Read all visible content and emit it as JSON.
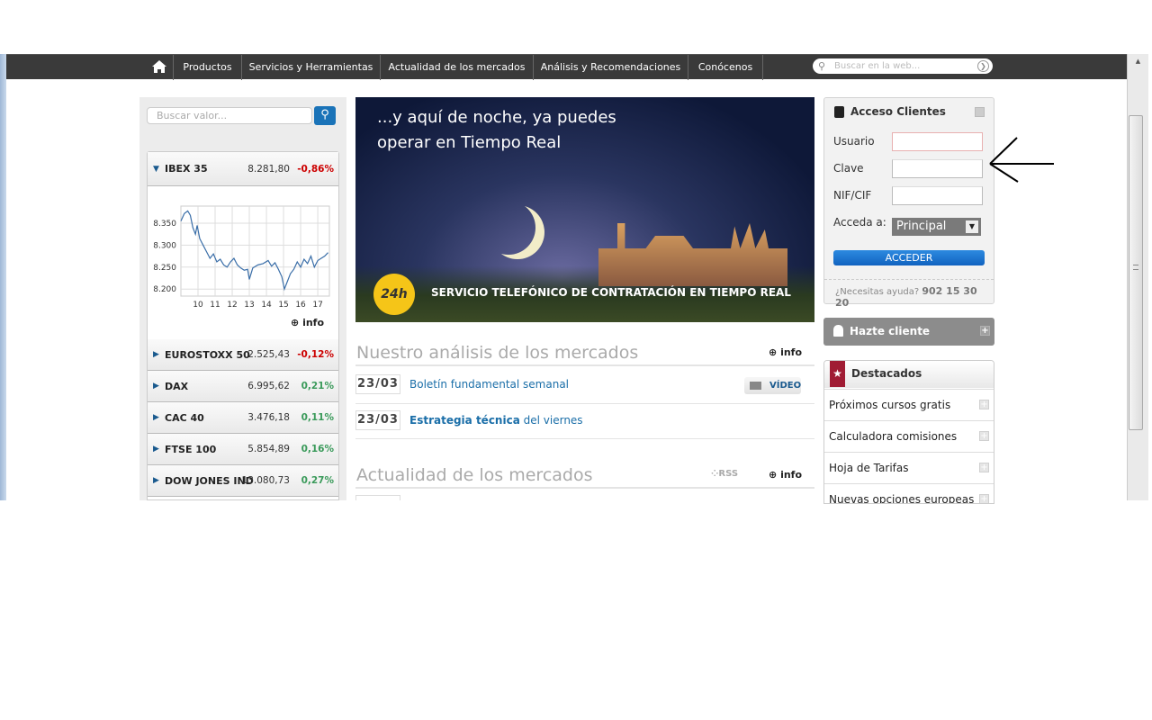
{
  "nav": {
    "items": [
      "Productos",
      "Servicios y Herramientas",
      "Actualidad de los mercados",
      "Análisis y Recomendaciones",
      "Conócenos"
    ],
    "search_placeholder": "Buscar en la web..."
  },
  "left": {
    "search_placeholder": "Buscar valor...",
    "indices": [
      {
        "name": "IBEX 35",
        "value": "8.281,80",
        "change": "-0,86%",
        "dir": "neg"
      },
      {
        "name": "EUROSTOXX 50",
        "value": "2.525,43",
        "change": "-0,12%",
        "dir": "neg"
      },
      {
        "name": "DAX",
        "value": "6.995,62",
        "change": "0,21%",
        "dir": "pos"
      },
      {
        "name": "CAC 40",
        "value": "3.476,18",
        "change": "0,11%",
        "dir": "pos"
      },
      {
        "name": "FTSE 100",
        "value": "5.854,89",
        "change": "0,16%",
        "dir": "pos"
      },
      {
        "name": "DOW JONES IND",
        "value": "13.080,73",
        "change": "0,27%",
        "dir": "pos"
      }
    ],
    "info_label": "info",
    "ibex_chart": {
      "type": "line",
      "y_ticks": [
        "8.350",
        "8.300",
        "8.250",
        "8.200"
      ],
      "y_tick_values": [
        8350,
        8300,
        8250,
        8200
      ],
      "x_ticks": [
        "10",
        "11",
        "12",
        "13",
        "14",
        "15",
        "16",
        "17"
      ],
      "x_tick_values": [
        10,
        11,
        12,
        13,
        14,
        15,
        16,
        17
      ],
      "xlim": [
        9.0,
        17.68
      ],
      "ylim": [
        8184,
        8389
      ],
      "x": [
        9.0,
        9.2,
        9.4,
        9.55,
        9.7,
        9.85,
        9.95,
        10.1,
        10.3,
        10.5,
        10.7,
        10.9,
        11.1,
        11.3,
        11.5,
        11.7,
        11.9,
        12.1,
        12.3,
        12.5,
        12.7,
        12.9,
        13.0,
        13.2,
        13.5,
        13.8,
        14.1,
        14.3,
        14.5,
        14.7,
        14.9,
        15.05,
        15.2,
        15.4,
        15.6,
        15.8,
        16.0,
        16.2,
        16.4,
        16.6,
        16.8,
        17.0,
        17.2,
        17.4,
        17.6
      ],
      "y": [
        8355,
        8372,
        8378,
        8368,
        8340,
        8325,
        8345,
        8315,
        8300,
        8285,
        8270,
        8280,
        8262,
        8268,
        8255,
        8250,
        8262,
        8270,
        8255,
        8248,
        8243,
        8245,
        8222,
        8248,
        8255,
        8258,
        8265,
        8252,
        8260,
        8245,
        8228,
        8200,
        8215,
        8235,
        8245,
        8262,
        8250,
        8268,
        8258,
        8275,
        8250,
        8265,
        8270,
        8275,
        8283
      ]
    }
  },
  "banner": {
    "headline_1": "...y aquí de noche, ya puedes",
    "headline_2": "operar en Tiempo Real",
    "badge": "24h",
    "caption": "SERVICIO TELEFÓNICO DE CONTRATACIÓN EN TIEMPO REAL"
  },
  "analysis": {
    "title": "Nuestro análisis de los mercados",
    "info": "info",
    "items": [
      {
        "date": "23/03",
        "title_bold": "",
        "title": "Boletín fundamental semanal",
        "video": "VÍDEO"
      },
      {
        "date": "23/03",
        "title_bold": "Estrategia técnica",
        "title": " del viernes"
      }
    ]
  },
  "news": {
    "title": "Actualidad de los mercados",
    "rss": "RSS",
    "info": "info"
  },
  "login": {
    "title": "Acceso Clientes",
    "user_label": "Usuario",
    "pass_label": "Clave",
    "nif_label": "NIF/CIF",
    "access_label": "Acceda a:",
    "access_value": "Principal",
    "submit": "ACCEDER",
    "help": "¿Necesitas ayuda?",
    "phone": "902 15 30 20"
  },
  "hazte": {
    "label": "Hazte cliente"
  },
  "destacados": {
    "title": "Destacados",
    "items": [
      "Próximos cursos gratis",
      "Calculadora comisiones",
      "Hoja de Tarifas",
      "Nuevas opciones europeas"
    ]
  },
  "colors": {
    "nav": "#3a3a3a",
    "accent": "#1a73b8",
    "negative": "#cc0000",
    "positive": "#3a9a5a",
    "destacados": "#a01c34"
  }
}
